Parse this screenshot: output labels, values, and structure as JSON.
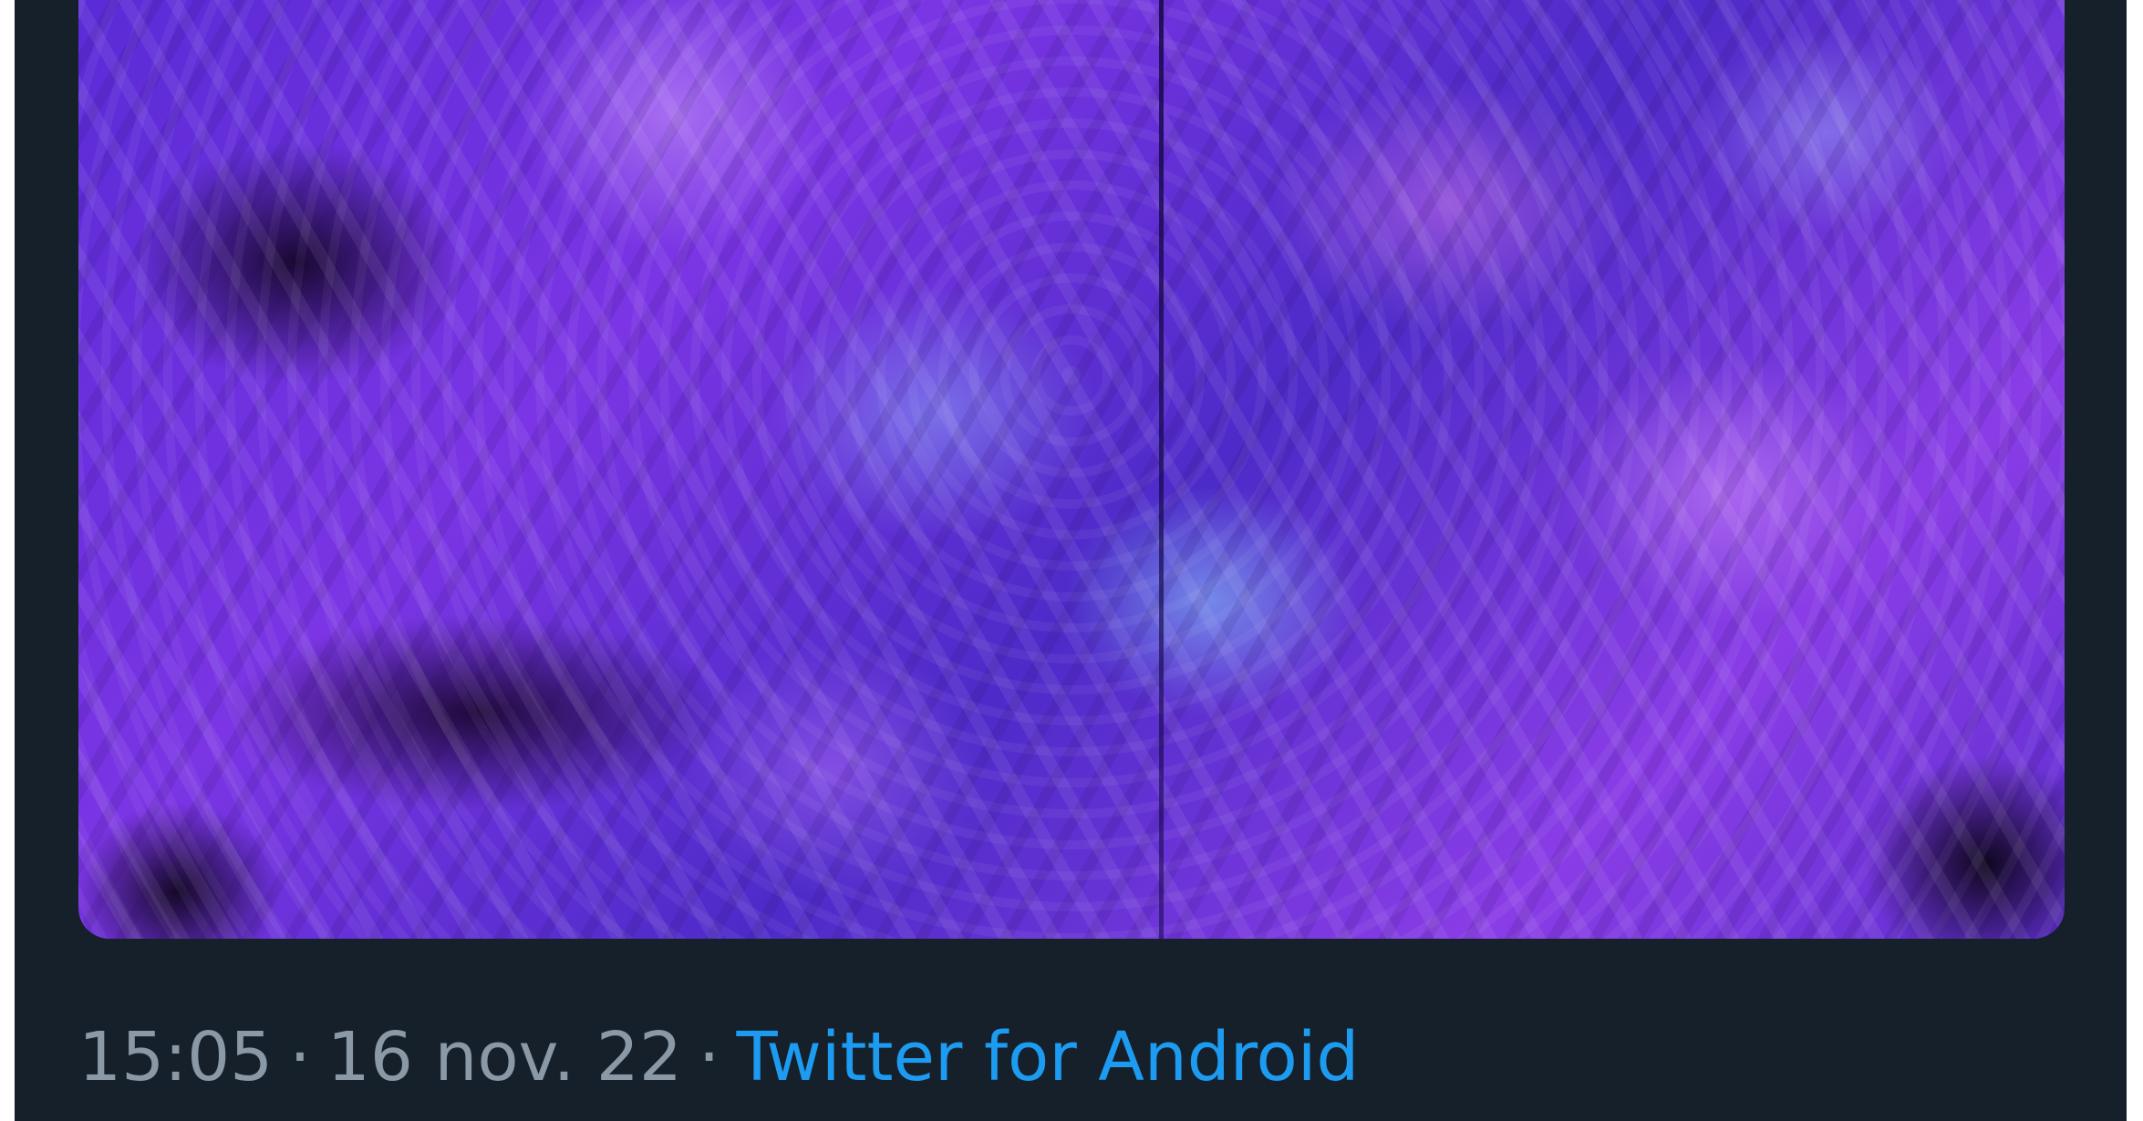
{
  "tweet": {
    "media": {
      "description_icon": "photo-media"
    },
    "meta": {
      "time": "15:05",
      "separator": "·",
      "date": "16 nov. 22",
      "source": "Twitter for Android"
    }
  },
  "colors": {
    "background": "#15202b",
    "meta_text": "#8b98a5",
    "link": "#1d9bf0"
  }
}
